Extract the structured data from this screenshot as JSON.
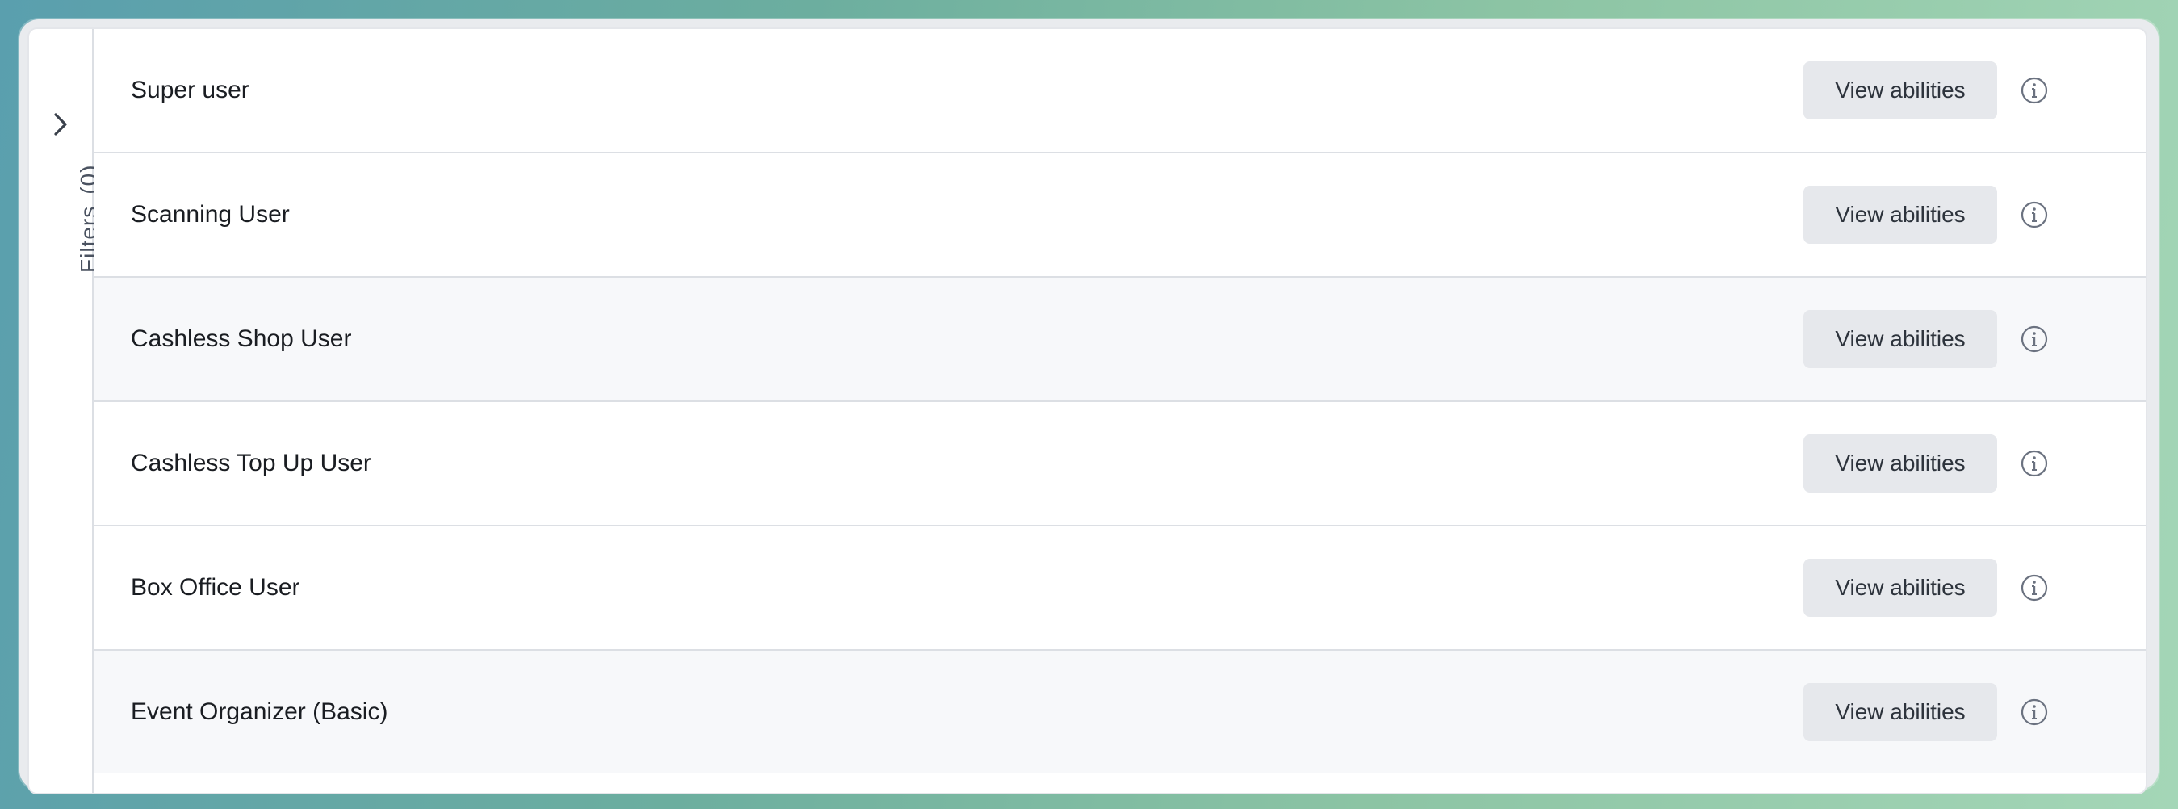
{
  "filters": {
    "label": "Filters",
    "count": "(0)",
    "toggle_icon": "chevron-right-icon"
  },
  "rows": [
    {
      "label": "Super user",
      "button": "View abilities",
      "icon": "info-icon"
    },
    {
      "label": "Scanning User",
      "button": "View abilities",
      "icon": "info-icon"
    },
    {
      "label": "Cashless Shop User",
      "button": "View abilities",
      "icon": "info-icon"
    },
    {
      "label": "Cashless Top Up User",
      "button": "View abilities",
      "icon": "info-icon"
    },
    {
      "label": "Box Office User",
      "button": "View abilities",
      "icon": "info-icon"
    },
    {
      "label": "Event Organizer (Basic)",
      "button": "View abilities",
      "icon": "info-icon"
    }
  ],
  "colors": {
    "row_shaded": "#f7f8fa",
    "button_bg": "#e6e8ec",
    "text": "#1a1d22"
  }
}
